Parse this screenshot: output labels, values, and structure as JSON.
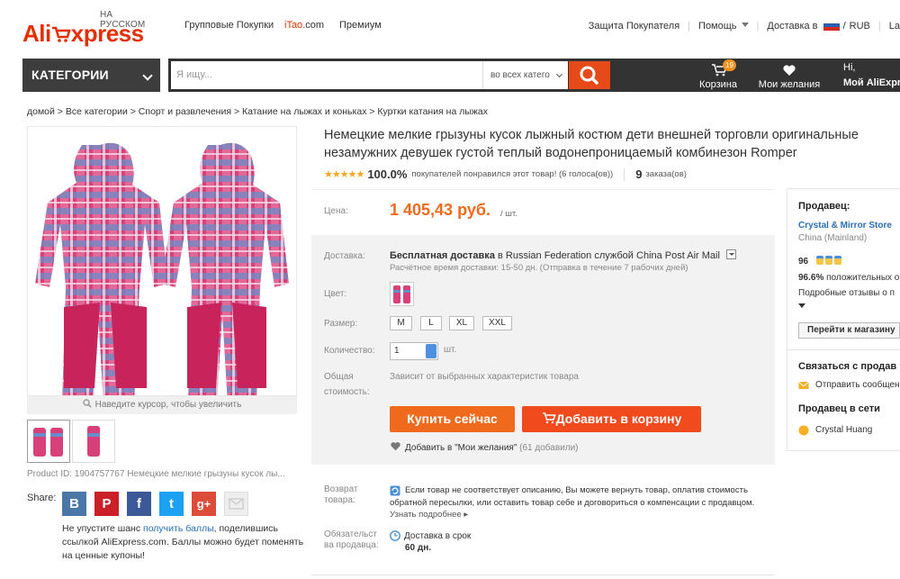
{
  "header": {
    "logo_main": "AliExpress",
    "logo_sub": "НА РУССКОМ",
    "nav": [
      "Групповые Покупки",
      "iTao.com",
      "Премиум"
    ],
    "itao_a": "iTao",
    "itao_b": ".com",
    "buyer_protection": "Защита Покупателя",
    "help": "Помощь",
    "ship_to": "Доставка в",
    "currency": "RUB",
    "lang_fragment": "La"
  },
  "search": {
    "categories_label": "КАТЕГОРИИ",
    "placeholder": "Я ищу...",
    "scope": "во всех катего",
    "cart_label": "Корзина",
    "cart_count": "19",
    "wishlist_label": "Мои желания",
    "greeting": "Hi,",
    "account": "Мой AliExpre"
  },
  "breadcrumb": "домой > Все категории > Спорт и развлечения > Катание на лыжах и коньках > Куртки катания на лыжах",
  "gallery": {
    "zoom_hint": "Наведите курсор, чтобы увеличить",
    "product_id": "Product ID: 1904757767 Немецкие мелкие грызуны кусок лы...",
    "share_label": "Share:",
    "share_buttons": [
      "B",
      "P",
      "f",
      "t",
      "g+"
    ],
    "promo_pre": "Не упустите шанс ",
    "promo_link": "получить баллы",
    "promo_post": ", поделившись ссылкой AliExpress.com. Баллы можно будет поменять на ценные купоны!"
  },
  "product": {
    "title": "Немецкие мелкие грызуны кусок лыжный костюм дети внешней торговли оригинальные незамужних девушек густой теплый водонепроницаемый комбинезон Romper",
    "stars": "★★★★★",
    "rating_pct": "100.0%",
    "rating_text": "покупателей понравился этот товар! (6 голоса(ов))",
    "orders": "9",
    "orders_label": "заказа(ов)",
    "price_label": "Цена:",
    "price": "1 405,43 руб.",
    "price_unit": "/ шт.",
    "delivery_label": "Доставка:",
    "free_shipping": "Бесплатная доставка",
    "ship_in": "в",
    "ship_country": "Russian Federation",
    "ship_via": "службой China Post Air Mail",
    "ship_time": "Расчётное время доставки: 15-50 дн. (Отправка в течение 7 рабочих дней)",
    "color_label": "Цвет:",
    "size_label": "Размер:",
    "sizes": [
      "M",
      "L",
      "XL",
      "XXL"
    ],
    "qty_label": "Количество:",
    "qty_value": "1",
    "qty_unit": "шт.",
    "total_label_1": "Общая",
    "total_label_2": "стоимость:",
    "total_value": "Зависит от выбранных характеристик товара",
    "buy_now": "Купить сейчас",
    "add_to_cart": "Добавить в корзину",
    "wishlist_add": "Добавить в \"Мои желания\"",
    "wishlist_count": "(61 добавили)",
    "return_label_1": "Возврат",
    "return_label_2": "товара:",
    "return_text": "Если товар не соответствует описанию, Вы можете вернуть товар, оплатив стоимость обратной пересылки, или оставить товар себе и договориться о компенсации с продавцом.",
    "return_more": "Узнать подробнее",
    "guarantee_label_1": "Обязательст",
    "guarantee_label_2": "ва продавца:",
    "guarantee_text": "Доставка в срок",
    "guarantee_days": "60 дн."
  },
  "seller": {
    "heading": "Продавец:",
    "store_name": "Crystal & Mirror Store",
    "location": "China (Mainland)",
    "score": "96",
    "positive": "96.6%",
    "positive_label": "положительных о",
    "feedback_link": "Подробные отзывы о п",
    "store_button": "Перейти к магазину",
    "contact_heading": "Связаться с продав",
    "send_message": "Отправить сообщен",
    "online_heading": "Продавец в сети",
    "online_name": "Crystal Huang"
  },
  "colors": {
    "brand_red": "#e62e04",
    "search_orange": "#e64a19",
    "price_orange": "#f06a1d",
    "link_blue": "#2a6ebb",
    "dark_bar": "#333333"
  }
}
